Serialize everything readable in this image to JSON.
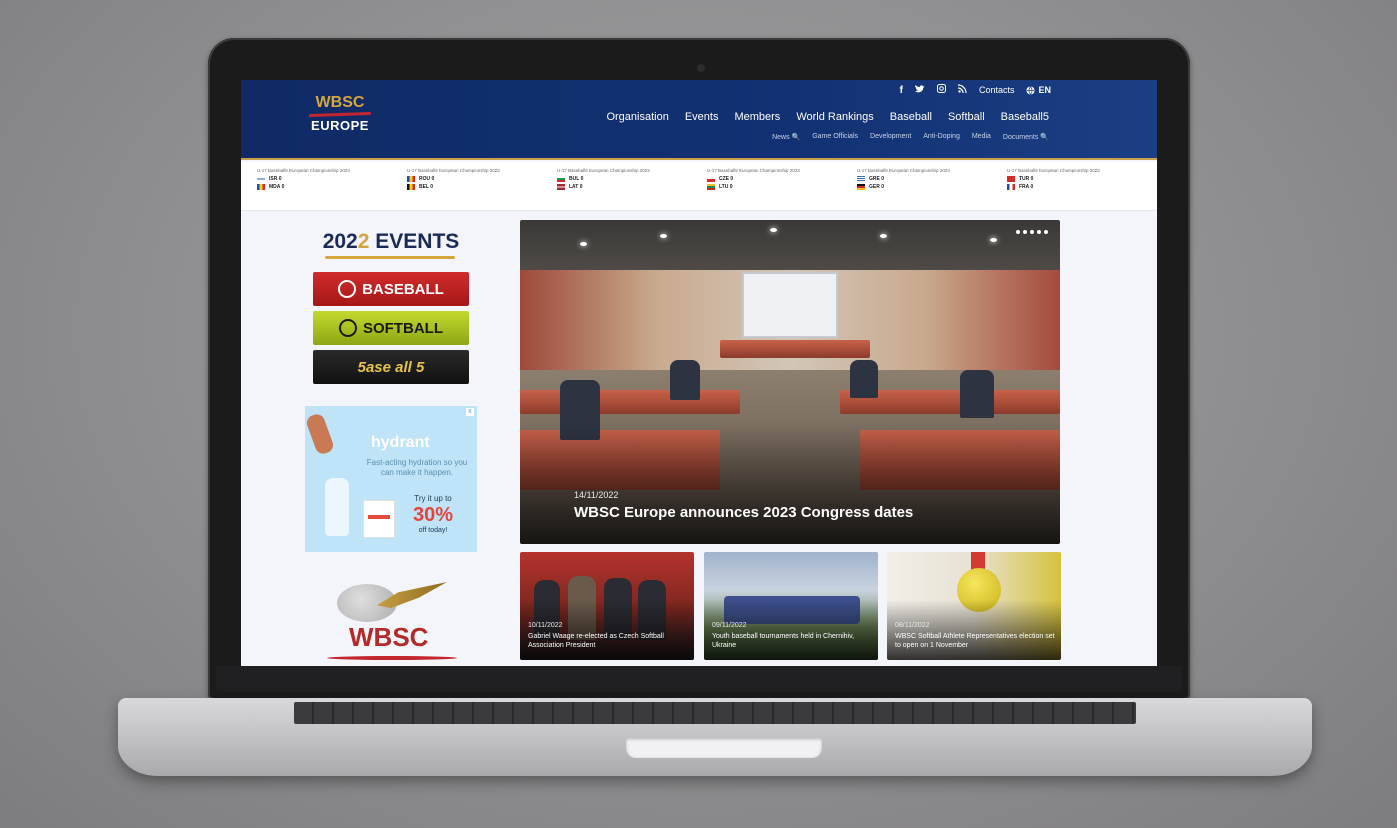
{
  "header": {
    "logo_top": "WBSC",
    "logo_bottom": "EUROPE",
    "utility": {
      "facebook": "f",
      "twitter": "🐦",
      "instagram": "◎",
      "rss": "⌁",
      "contacts": "Contacts",
      "language_icon": "🌐",
      "language": "EN"
    },
    "main_nav": [
      "Organisation",
      "Events",
      "Members",
      "World Rankings",
      "Baseball",
      "Softball",
      "Baseball5"
    ],
    "sub_nav": [
      "News 🔍",
      "Game Officials",
      "Development",
      "Anti-Doping",
      "Media",
      "Documents 🔍"
    ]
  },
  "ticker": [
    {
      "title": "U-17 Baseball5 European Championship 2023",
      "time": "",
      "team1": "ISR 0",
      "team2": "MDA 0"
    },
    {
      "title": "U-17 Baseball5 European Championship 2023",
      "time": "",
      "team1": "ROU 0",
      "team2": "BEL 0"
    },
    {
      "title": "U-17 Baseball5 European Championship 2023",
      "time": "",
      "team1": "BUL 0",
      "team2": "LAT 0"
    },
    {
      "title": "U-17 Baseball5 European Championship 2023",
      "time": "",
      "team1": "CZE 0",
      "team2": "LTU 0"
    },
    {
      "title": "U-17 Baseball5 European Championship 2023",
      "time": "",
      "team1": "GRE 0",
      "team2": "GER 0"
    },
    {
      "title": "U-17 Baseball5 European Championship 2023",
      "time": "",
      "team1": "TUR 0",
      "team2": "FRA 0"
    }
  ],
  "sidebar": {
    "events_title_prefix": "202",
    "events_title_accent": "2",
    "events_title_suffix": " EVENTS",
    "buttons": {
      "baseball": "BASEBALL",
      "softball": "SOFTBALL",
      "baseball5": "5ase all 5"
    },
    "ad": {
      "brand": "hydrant",
      "copy": "Fast-acting hydration so you can make it happen.",
      "cta": "Try it up to",
      "percent": "30%",
      "small": "off today!"
    },
    "wbsc_logo_text": "WBSC"
  },
  "hero": {
    "date": "14/11/2022",
    "title": "WBSC Europe announces 2023 Congress dates"
  },
  "cards": [
    {
      "date": "10/11/2022",
      "title": "Gabriel Waage re-elected as Czech Softball Association President"
    },
    {
      "date": "09/11/2022",
      "title": "Youth baseball tournaments held in Chernihiv, Ukraine"
    },
    {
      "date": "08/11/2022",
      "title": "WBSC Softball Athlete Representatives election set to open on 1 November"
    }
  ],
  "colors": {
    "header_blue": "#0f2a66",
    "gold": "#d5a63c",
    "brand_red": "#c2262e",
    "softball_green": "#a8c21f"
  }
}
